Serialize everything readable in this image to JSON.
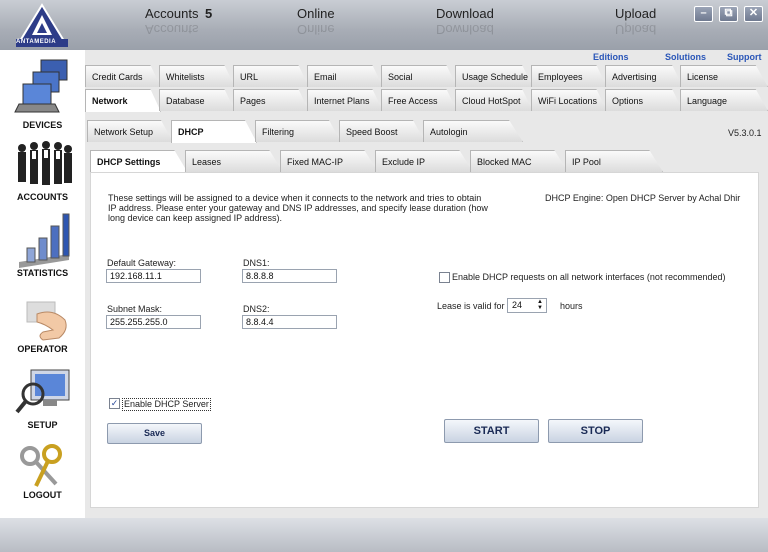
{
  "window": {
    "logo_text": "ANTAMEDIA",
    "controls": [
      "–",
      "⧉",
      "✕"
    ]
  },
  "top_links": [
    "Editions",
    "Solutions",
    "Support"
  ],
  "sidebar": {
    "items": [
      {
        "label": "DEVICES",
        "icon": "computers-icon"
      },
      {
        "label": "ACCOUNTS",
        "icon": "people-icon"
      },
      {
        "label": "STATISTICS",
        "icon": "bar-chart-icon"
      },
      {
        "label": "OPERATOR",
        "icon": "hand-card-icon"
      },
      {
        "label": "SETUP",
        "icon": "monitor-magnifier-icon"
      },
      {
        "label": "LOGOUT",
        "icon": "keys-icon"
      }
    ]
  },
  "tabs_row1": [
    "Credit Cards",
    "Whitelists",
    "URL",
    "Email",
    "Social",
    "Usage Schedule",
    "Employees",
    "Advertising",
    "License"
  ],
  "tabs_row2": [
    "Network",
    "Database",
    "Pages",
    "Internet Plans",
    "Free Access",
    "Cloud HotSpot",
    "WiFi Locations",
    "Options",
    "Language"
  ],
  "tabs_row3": [
    "Network Setup",
    "DHCP",
    "Filtering",
    "Speed Boost",
    "Autologin"
  ],
  "tabs_row4": [
    "DHCP Settings",
    "Leases",
    "Fixed MAC-IP",
    "Exclude IP",
    "Blocked MAC",
    "IP Pool"
  ],
  "version": "V5.3.0.1",
  "dhcp": {
    "intro_line1": "These settings will be assigned to a device when it connects to the network and tries to obtain",
    "intro_line2": "IP address. Please enter your gateway and DNS IP addresses, and specify lease duration (how",
    "intro_line3": "long device can keep assigned IP address).",
    "engine": "DHCP Engine: Open DHCP Server by Achal Dhir",
    "gateway_label": "Default Gateway:",
    "gateway_value": "192.168.11.1",
    "dns1_label": "DNS1:",
    "dns1_value": "8.8.8.8",
    "subnet_label": "Subnet Mask:",
    "subnet_value": "255.255.255.0",
    "dns2_label": "DNS2:",
    "dns2_value": "8.8.4.4",
    "all_interfaces_label": "Enable DHCP requests on all network interfaces (not recommended)",
    "all_interfaces_checked": false,
    "lease_label": "Lease is valid for",
    "lease_value": "24",
    "lease_unit": "hours",
    "enable_label": "Enable DHCP Server",
    "enable_checked": true,
    "save_label": "Save",
    "start_label": "START",
    "stop_label": "STOP"
  },
  "status": {
    "accounts_label": "Accounts",
    "accounts_count": "5",
    "online_label": "Online",
    "download_label": "Download",
    "upload_label": "Upload"
  },
  "colors": {
    "link": "#2a56b8",
    "titlebar": "#a8adb6",
    "panel": "#e8e8e8"
  }
}
